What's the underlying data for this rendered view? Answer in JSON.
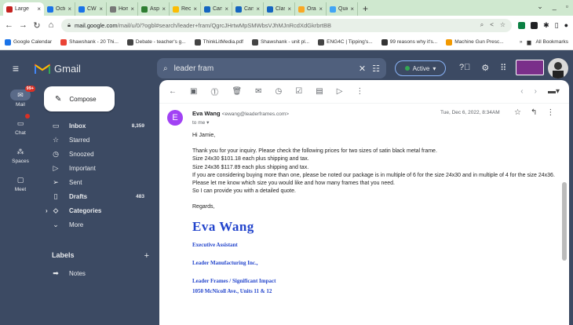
{
  "browser": {
    "tabs": [
      {
        "label": "Large",
        "color": "#c5221f",
        "active": true
      },
      {
        "label": "Octob",
        "color": "#1a73e8"
      },
      {
        "label": "CW Gl",
        "color": "#1a73e8"
      },
      {
        "label": "Home",
        "color": "#777777"
      },
      {
        "label": "Aspen",
        "color": "#2e7d32"
      },
      {
        "label": "Recen",
        "color": "#fbbc04"
      },
      {
        "label": "Canad",
        "color": "#1565c0"
      },
      {
        "label": "Canad",
        "color": "#1565c0"
      },
      {
        "label": "Classi",
        "color": "#1565c0"
      },
      {
        "label": "Oral P",
        "color": "#f9a825"
      },
      {
        "label": "Quick",
        "color": "#42a5f5"
      }
    ],
    "new_tab": "+",
    "url_host": "mail.google.com",
    "url_path": "/mail/u/0/?ogbl#search/leader+fram/QgrcJHrtwMpSMWbsVJhMJnRcdXdGkrbrtBB",
    "bookmarks": [
      {
        "label": "Google Calendar",
        "color": "#1a73e8"
      },
      {
        "label": "Shawshank - 20 Thi...",
        "color": "#ea4335"
      },
      {
        "label": "Debate - teacher's g...",
        "color": "#444444"
      },
      {
        "label": "ThinkLitMedia.pdf",
        "color": "#444444"
      },
      {
        "label": "Shawshank - unit pl...",
        "color": "#444444"
      },
      {
        "label": "ENG4C | Tipping's...",
        "color": "#444444"
      },
      {
        "label": "99 reasons why it's...",
        "color": "#333333"
      },
      {
        "label": "Machine Gun Presc...",
        "color": "#f29900"
      }
    ],
    "all_bookmarks": "All Bookmarks"
  },
  "gmail": {
    "product_name": "Gmail",
    "search_value": "leader fram",
    "status_label": "Active",
    "accent": "#8ab4f8",
    "rail": [
      {
        "label": "Mail",
        "badge": "99+",
        "selected": true
      },
      {
        "label": "Chat",
        "badge": "",
        "selected": false
      },
      {
        "label": "Spaces",
        "badge": "",
        "selected": false
      },
      {
        "label": "Meet",
        "badge": "",
        "selected": false
      }
    ],
    "compose_label": "Compose",
    "nav": [
      {
        "label": "Inbox",
        "count": "8,359",
        "bold": true,
        "icon": "inbox-icon"
      },
      {
        "label": "Starred",
        "count": "",
        "bold": false,
        "icon": "star-icon"
      },
      {
        "label": "Snoozed",
        "count": "",
        "bold": false,
        "icon": "clock-icon"
      },
      {
        "label": "Important",
        "count": "",
        "bold": false,
        "icon": "important-icon"
      },
      {
        "label": "Sent",
        "count": "",
        "bold": false,
        "icon": "send-icon"
      },
      {
        "label": "Drafts",
        "count": "483",
        "bold": true,
        "icon": "draft-icon"
      },
      {
        "label": "Categories",
        "count": "",
        "bold": true,
        "icon": "label-icon"
      },
      {
        "label": "More",
        "count": "",
        "bold": false,
        "icon": "chevron-down-icon"
      }
    ],
    "labels_header": "Labels",
    "labels": [
      {
        "label": "Notes"
      }
    ]
  },
  "message": {
    "avatar_letter": "E",
    "sender_name": "Eva Wang",
    "sender_email": "<ewang@leaderframes.com>",
    "to": "to me",
    "date": "Tue, Dec 6, 2022, 8:34AM",
    "greeting": "Hi Jamie,",
    "lines": [
      "Thank you for your inquiry. Please check the following prices for two sizes of satin black metal frame.",
      "Size 24x30   $101.18 each plus shipping and tax.",
      "Size 24x36   $117.89 each plus shipping and tax.",
      "If you are considering buying more than one, please be noted our package is in multiple of 6 for the size 24x30 and in multiple of 4 for the size 24x36.",
      "Please let me know which size you would like and how many frames that you need.",
      "So I can provide you with a detailed quote."
    ],
    "closing": "Regards,",
    "signature": {
      "name": "Eva Wang",
      "title": "Executive Assistant",
      "company": "Leader Manufacturing Inc.,",
      "brand": "Leader Frames / Significant Impact",
      "address": "1050 McNicoll Ave., Units 11 & 12"
    }
  }
}
